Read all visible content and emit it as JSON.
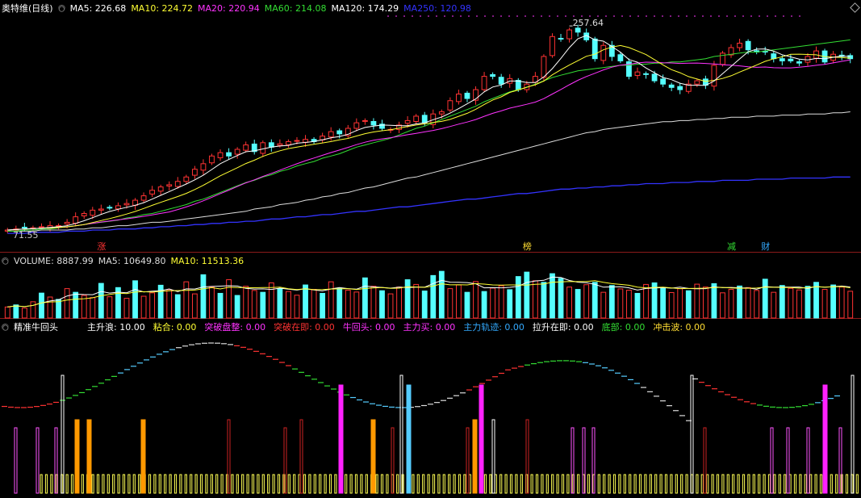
{
  "chart_data": [
    {
      "type": "candlestick",
      "title": "奥特维(日线)",
      "indicators": [
        {
          "name": "MA5",
          "value": "226.68",
          "color": "#ffffff"
        },
        {
          "name": "MA10",
          "value": "224.72",
          "color": "#ffff33"
        },
        {
          "name": "MA20",
          "value": "220.94",
          "color": "#ff33ff"
        },
        {
          "name": "MA60",
          "value": "214.08",
          "color": "#33dd33"
        },
        {
          "name": "MA120",
          "value": "174.29",
          "color": "#ffffff"
        },
        {
          "name": "MA250",
          "value": "120.98",
          "color": "#3333ff"
        }
      ],
      "peak_label": "257.64",
      "low_label": "71.55",
      "ylim": [
        65,
        265
      ],
      "x_count": 100,
      "close": [
        73,
        74,
        75,
        75,
        76,
        77,
        77,
        80,
        85,
        88,
        91,
        92,
        93,
        95,
        97,
        100,
        104,
        109,
        112,
        114,
        117,
        121,
        128,
        133,
        140,
        143,
        140,
        146,
        150,
        144,
        152,
        148,
        151,
        153,
        154,
        155,
        153,
        158,
        162,
        160,
        165,
        170,
        172,
        168,
        165,
        164,
        168,
        172,
        176,
        170,
        178,
        180,
        190,
        196,
        192,
        200,
        212,
        212,
        205,
        210,
        200,
        205,
        212,
        230,
        248,
        246,
        254,
        252,
        245,
        228,
        240,
        230,
        226,
        212,
        216,
        214,
        208,
        205,
        202,
        200,
        205,
        208,
        204,
        222,
        233,
        238,
        242,
        236,
        234,
        234,
        228,
        226,
        226,
        224,
        230,
        235,
        225,
        232,
        230,
        228
      ],
      "ma60": [
        72,
        72,
        73,
        73,
        74,
        74,
        75,
        76,
        77,
        78,
        79,
        80,
        81,
        82,
        84,
        85,
        87,
        88,
        90,
        92,
        94,
        96,
        99,
        101,
        104,
        107,
        110,
        113,
        116,
        118,
        121,
        123,
        126,
        128,
        131,
        133,
        135,
        138,
        140,
        142,
        145,
        148,
        150,
        152,
        154,
        156,
        159,
        162,
        165,
        167,
        170,
        173,
        176,
        179,
        182,
        185,
        189,
        192,
        195,
        198,
        200,
        202,
        205,
        208,
        211,
        213,
        215,
        217,
        218,
        219,
        220,
        221,
        222,
        222,
        223,
        223,
        224,
        224,
        225,
        225,
        226,
        227,
        228,
        230,
        231,
        232,
        233,
        234,
        234,
        235,
        236,
        237,
        238,
        239,
        240,
        241,
        242,
        243,
        244,
        245
      ],
      "ma120": [
        72,
        72,
        72,
        72,
        73,
        73,
        73,
        73,
        74,
        74,
        75,
        75,
        76,
        77,
        77,
        78,
        79,
        80,
        80,
        81,
        82,
        83,
        84,
        85,
        86,
        87,
        88,
        89,
        90,
        92,
        93,
        94,
        96,
        97,
        98,
        100,
        101,
        103,
        104,
        106,
        107,
        109,
        111,
        112,
        114,
        116,
        118,
        120,
        121,
        123,
        125,
        127,
        129,
        131,
        133,
        135,
        137,
        139,
        141,
        143,
        145,
        147,
        149,
        151,
        153,
        155,
        157,
        159,
        161,
        162,
        164,
        165,
        166,
        167,
        168,
        169,
        170,
        171,
        171,
        172,
        172,
        173,
        173,
        174,
        174,
        175,
        175,
        175,
        176,
        176,
        176,
        177,
        177,
        177,
        178,
        178,
        178,
        179,
        179,
        180
      ],
      "ma250": [
        70,
        70,
        70,
        71,
        71,
        71,
        71,
        72,
        72,
        72,
        73,
        73,
        73,
        74,
        74,
        74,
        75,
        75,
        76,
        76,
        77,
        77,
        78,
        78,
        79,
        79,
        80,
        80,
        81,
        81,
        82,
        83,
        83,
        84,
        85,
        85,
        86,
        87,
        87,
        88,
        89,
        90,
        90,
        91,
        92,
        93,
        94,
        94,
        95,
        96,
        97,
        98,
        99,
        100,
        101,
        101,
        102,
        103,
        104,
        105,
        106,
        106,
        107,
        108,
        109,
        110,
        110,
        111,
        111,
        112,
        112,
        113,
        113,
        114,
        114,
        115,
        115,
        115,
        116,
        116,
        116,
        117,
        117,
        117,
        118,
        118,
        118,
        118,
        119,
        119,
        119,
        119,
        120,
        120,
        120,
        120,
        120,
        121,
        121,
        121
      ],
      "event_labels": [
        {
          "text": "涨",
          "color": "#ff3333",
          "index": 11
        },
        {
          "text": "榜",
          "color": "#ffdd33",
          "index": 61
        },
        {
          "text": "减",
          "color": "#33dd33",
          "index": 85
        },
        {
          "text": "财",
          "color": "#33aaff",
          "index": 89
        }
      ]
    },
    {
      "type": "bar",
      "title": "VOLUME",
      "indicators": [
        {
          "name": "VOLUME",
          "value": "8887.99",
          "color": "#dddddd"
        },
        {
          "name": "MA5",
          "value": "10649.80",
          "color": "#dddddd"
        },
        {
          "name": "MA10",
          "value": "11513.36",
          "color": "#ffff33"
        }
      ],
      "ylim": [
        0,
        20000
      ],
      "values": [
        4200,
        5000,
        3800,
        6200,
        9500,
        8000,
        7100,
        11200,
        9800,
        8600,
        7800,
        13200,
        8100,
        11600,
        7500,
        14200,
        8300,
        9600,
        12500,
        10800,
        8900,
        13800,
        9200,
        16500,
        11800,
        9400,
        14600,
        8600,
        12100,
        10500,
        9800,
        13400,
        11200,
        10100,
        8700,
        12600,
        10900,
        9400,
        13800,
        11300,
        10600,
        9900,
        15300,
        12100,
        10400,
        9200,
        11800,
        14600,
        12800,
        10300,
        16200,
        17800,
        11200,
        12600,
        9800,
        13900,
        10100,
        11400,
        12300,
        10800,
        15800,
        17500,
        14200,
        13600,
        16900,
        15100,
        11800,
        10900,
        12700,
        13600,
        9800,
        12400,
        11100,
        10600,
        9400,
        12800,
        13400,
        11600,
        9700,
        11200,
        10400,
        12900,
        11800,
        13100,
        9600,
        10900,
        12200,
        11600,
        10500,
        14800,
        9800,
        12400,
        11300,
        10700,
        12100,
        13600,
        10900,
        12600,
        11800,
        10200
      ],
      "up": [
        1,
        0,
        1,
        1,
        0,
        1,
        0,
        1,
        0,
        1,
        1,
        0,
        1,
        0,
        1,
        0,
        1,
        1,
        0,
        1,
        0,
        1,
        1,
        0,
        1,
        0,
        1,
        0,
        1,
        1,
        0,
        1,
        0,
        1,
        1,
        0,
        1,
        0,
        1,
        0,
        1,
        1,
        0,
        1,
        0,
        1,
        1,
        0,
        1,
        0,
        0,
        0,
        1,
        1,
        0,
        1,
        0,
        1,
        1,
        0,
        0,
        0,
        1,
        0,
        0,
        0,
        1,
        0,
        1,
        0,
        1,
        0,
        1,
        1,
        0,
        1,
        0,
        0,
        1,
        1,
        0,
        1,
        1,
        0,
        1,
        1,
        0,
        1,
        1,
        0,
        1,
        0,
        1,
        1,
        0,
        0,
        1,
        0,
        1,
        1
      ]
    },
    {
      "type": "bar",
      "title": "精准牛回头",
      "indicators": [
        {
          "name": "主升浪",
          "value": "10.00",
          "color": "#ffffff"
        },
        {
          "name": "粘合",
          "value": "0.00",
          "color": "#ffff33"
        },
        {
          "name": "突破盘整",
          "value": "0.00",
          "color": "#ff33ff"
        },
        {
          "name": "突破在即",
          "value": "0.00",
          "color": "#ff3333"
        },
        {
          "name": "牛回头",
          "value": "0.00",
          "color": "#ff33ff"
        },
        {
          "name": "主力买",
          "value": "0.00",
          "color": "#ff33ff"
        },
        {
          "name": "主力轨迹",
          "value": "0.00",
          "color": "#33aaff"
        },
        {
          "name": "拉升在即",
          "value": "0.00",
          "color": "#ffffff"
        },
        {
          "name": "底部",
          "value": "0.00",
          "color": "#33dd33"
        },
        {
          "name": "冲击波",
          "value": "0.00",
          "color": "#ffdd33"
        }
      ]
    }
  ],
  "colors": {
    "up": "#ff3333",
    "down": "#55ffff",
    "grid": "#8b1a1a"
  }
}
